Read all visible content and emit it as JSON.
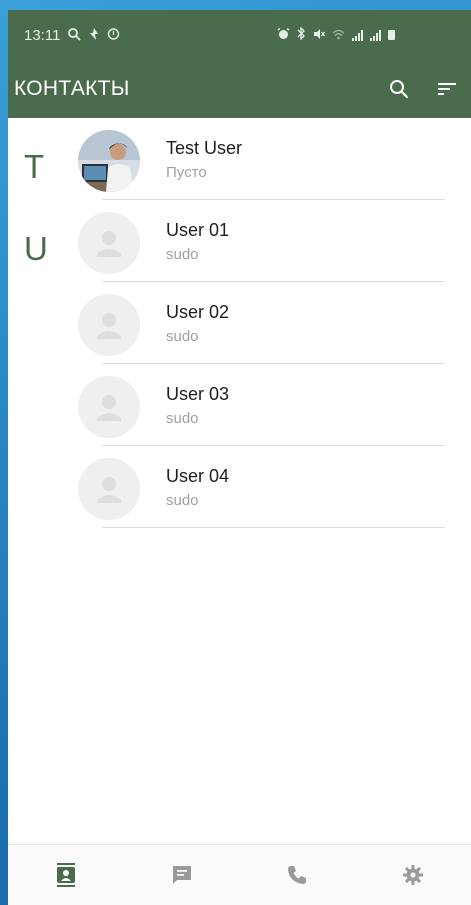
{
  "status_bar": {
    "time": "13:11"
  },
  "app_bar": {
    "title": "КОНТАКТЫ",
    "search_icon": "search-icon",
    "sort_icon": "sort-icon"
  },
  "sections": [
    {
      "letter": "T",
      "contacts": [
        {
          "name": "Test User",
          "status": "Пусто",
          "avatar": "photo"
        }
      ]
    },
    {
      "letter": "U",
      "contacts": [
        {
          "name": "User 01",
          "status": "sudo",
          "avatar": "placeholder"
        },
        {
          "name": "User 02",
          "status": "sudo",
          "avatar": "placeholder"
        },
        {
          "name": "User 03",
          "status": "sudo",
          "avatar": "placeholder"
        },
        {
          "name": "User 04",
          "status": "sudo",
          "avatar": "placeholder"
        }
      ]
    }
  ],
  "bottom_nav": {
    "items": [
      {
        "icon": "contacts-icon",
        "active": true
      },
      {
        "icon": "chat-icon",
        "active": false
      },
      {
        "icon": "phone-icon",
        "active": false
      },
      {
        "icon": "settings-icon",
        "active": false
      }
    ]
  },
  "colors": {
    "primary": "#4a6c4c",
    "text": "#1e1e1e",
    "subtext": "#a0a0a0",
    "background_outer": "#2a86c4"
  }
}
